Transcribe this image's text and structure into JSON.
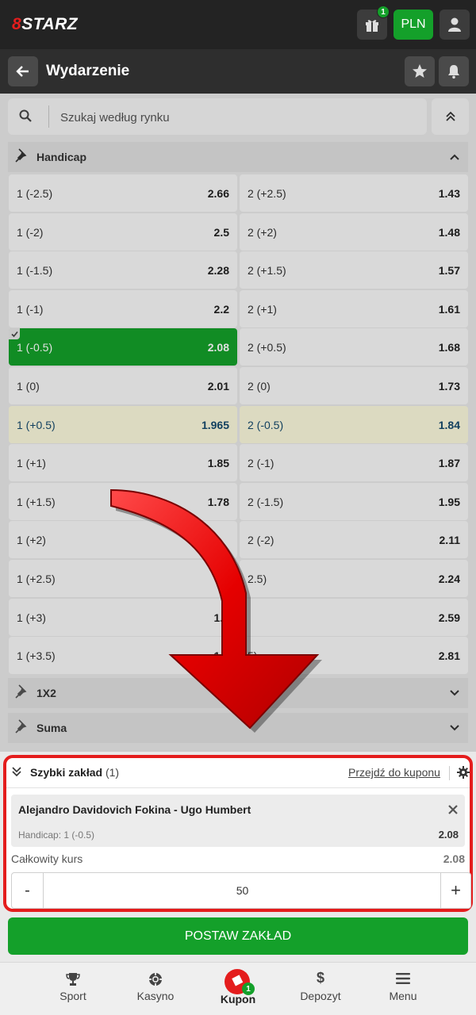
{
  "header": {
    "logo_prefix": "8",
    "logo_text": "STARZ",
    "gift_badge": "1",
    "currency": "PLN"
  },
  "page": {
    "title": "Wydarzenie"
  },
  "search": {
    "placeholder": "Szukaj według rynku"
  },
  "markets": {
    "handicap": "Handicap",
    "one_x_two": "1X2",
    "suma": "Suma"
  },
  "odds": [
    {
      "l1": "1 (-2.5)",
      "v1": "2.66",
      "l2": "2 (+2.5)",
      "v2": "1.43"
    },
    {
      "l1": "1 (-2)",
      "v1": "2.5",
      "l2": "2 (+2)",
      "v2": "1.48"
    },
    {
      "l1": "1 (-1.5)",
      "v1": "2.28",
      "l2": "2 (+1.5)",
      "v2": "1.57"
    },
    {
      "l1": "1 (-1)",
      "v1": "2.2",
      "l2": "2 (+1)",
      "v2": "1.61"
    },
    {
      "l1": "1 (-0.5)",
      "v1": "2.08",
      "l2": "2 (+0.5)",
      "v2": "1.68"
    },
    {
      "l1": "1 (0)",
      "v1": "2.01",
      "l2": "2 (0)",
      "v2": "1.73"
    },
    {
      "l1": "1 (+0.5)",
      "v1": "1.965",
      "l2": "2 (-0.5)",
      "v2": "1.84"
    },
    {
      "l1": "1 (+1)",
      "v1": "1.85",
      "l2": "2 (-1)",
      "v2": "1.87"
    },
    {
      "l1": "1 (+1.5)",
      "v1": "1.78",
      "l2": "2 (-1.5)",
      "v2": "1.95"
    },
    {
      "l1": "1 (+2)",
      "v1": "",
      "l2": "2 (-2)",
      "v2": "2.11"
    },
    {
      "l1": "1 (+2.5)",
      "v1": "",
      "l2": "2.5)",
      "v2": "2.24"
    },
    {
      "l1": "1 (+3)",
      "v1": "1.4",
      "l2": "",
      "v2": "2.59"
    },
    {
      "l1": "1 (+3.5)",
      "v1": "1.1",
      "l2": "5)",
      "v2": "2.81"
    }
  ],
  "quick_bet": {
    "title": "Szybki zakład",
    "count": "(1)",
    "coupon_link": "Przejdź do kuponu",
    "event": "Alejandro Davidovich Fokina - Ugo Humbert",
    "market": "Handicap: 1 (-0.5)",
    "odd": "2.08",
    "total_label": "Całkowity kurs",
    "total_value": "2.08",
    "minus": "-",
    "plus": "+",
    "stake": "50"
  },
  "place_bet": "POSTAW ZAKŁAD",
  "nav": {
    "sport": "Sport",
    "kasyno": "Kasyno",
    "kupon": "Kupon",
    "kupon_badge": "1",
    "depozyt": "Depozyt",
    "menu": "Menu"
  },
  "colors": {
    "accent_green": "#14a02a",
    "brand_red": "#e41d1d",
    "topbar": "#232323"
  }
}
